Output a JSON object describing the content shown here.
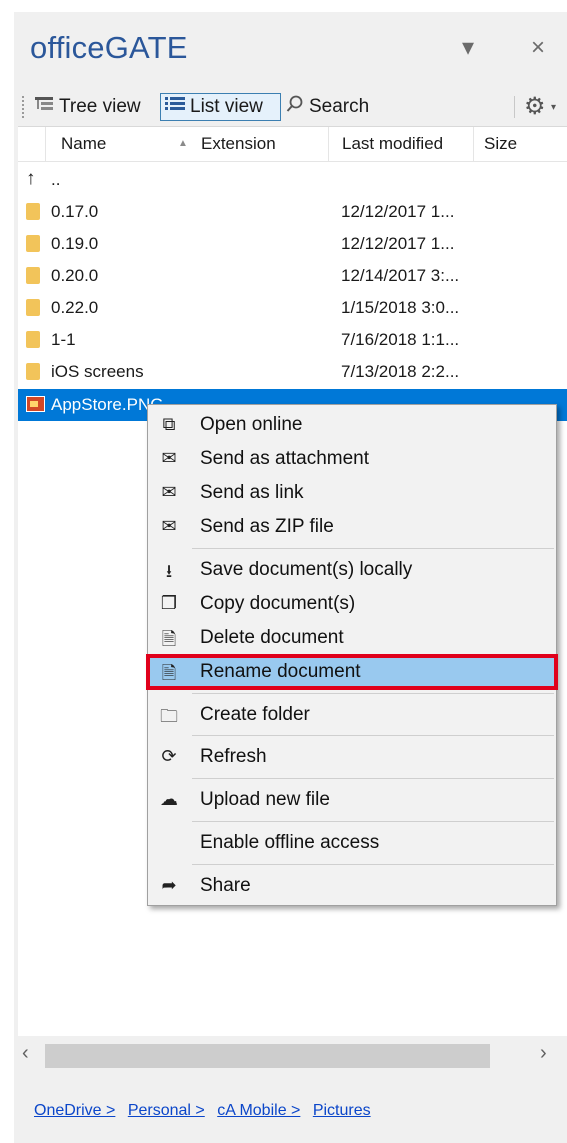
{
  "app": {
    "title": "officeGATE"
  },
  "title_buttons": {
    "dropdown_icon": "caret-down-icon",
    "close_glyph": "×"
  },
  "toolbar": {
    "tree_view": "Tree view",
    "list_view": "List view",
    "search": "Search",
    "settings_icon": "gear-icon"
  },
  "columns": {
    "name": "Name",
    "extension": "Extension",
    "last_modified": "Last modified",
    "size": "Size"
  },
  "rows": [
    {
      "name": "..",
      "type": "up",
      "modified": ""
    },
    {
      "name": "0.17.0",
      "type": "folder",
      "modified": "12/12/2017 1..."
    },
    {
      "name": "0.19.0",
      "type": "folder",
      "modified": "12/12/2017 1..."
    },
    {
      "name": "0.20.0",
      "type": "folder",
      "modified": "12/14/2017 3:..."
    },
    {
      "name": "0.22.0",
      "type": "folder",
      "modified": "1/15/2018 3:0..."
    },
    {
      "name": "1-1",
      "type": "folder",
      "modified": "7/16/2018 1:1..."
    },
    {
      "name": "iOS screens",
      "type": "folder",
      "modified": "7/13/2018 2:2..."
    },
    {
      "name": "AppStore.PNG",
      "type": "image",
      "modified": "",
      "selected": true
    }
  ],
  "context_menu": {
    "items": [
      {
        "label": "Open online",
        "icon": "open-external-icon"
      },
      {
        "label": "Send as attachment",
        "icon": "mail-attachment-icon"
      },
      {
        "label": "Send as link",
        "icon": "mail-link-icon"
      },
      {
        "label": "Send as ZIP file",
        "icon": "mail-zip-icon"
      },
      {
        "label": "Save document(s) locally",
        "icon": "download-icon"
      },
      {
        "label": "Copy document(s)",
        "icon": "copy-icon"
      },
      {
        "label": "Delete document",
        "icon": "delete-document-icon"
      },
      {
        "label": "Rename document",
        "icon": "rename-document-icon",
        "highlighted": true
      },
      {
        "label": "Create folder",
        "icon": "new-folder-icon"
      },
      {
        "label": "Refresh",
        "icon": "refresh-icon"
      },
      {
        "label": "Upload new file",
        "icon": "upload-icon"
      },
      {
        "label": "Enable offline access",
        "icon": ""
      },
      {
        "label": "Share",
        "icon": "share-icon"
      }
    ]
  },
  "breadcrumb": [
    "OneDrive >",
    "Personal >",
    "cA Mobile >",
    "Pictures"
  ],
  "colors": {
    "title": "#2b579a",
    "selection": "#0078d7",
    "menu_highlight": "#99c9ef",
    "callout": "#e0001b"
  }
}
